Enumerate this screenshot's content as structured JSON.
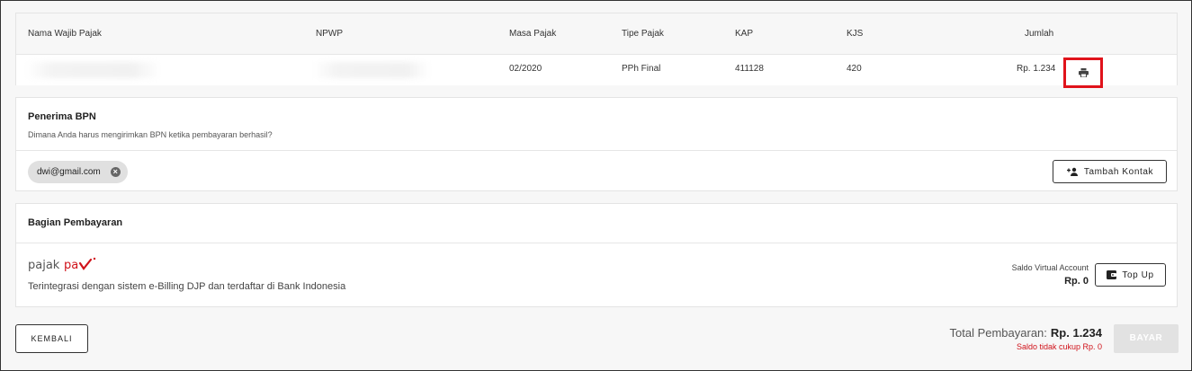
{
  "table": {
    "headers": {
      "nama": "Nama Wajib Pajak",
      "npwp": "NPWP",
      "masa": "Masa Pajak",
      "tipe": "Tipe Pajak",
      "kap": "KAP",
      "kjs": "KJS",
      "jumlah": "Jumlah"
    },
    "row": {
      "nama": "",
      "npwp": "",
      "masa": "02/2020",
      "tipe": "PPh Final",
      "kap": "411128",
      "kjs": "420",
      "jumlah": "Rp. 1.234"
    },
    "print_icon": "printer-icon",
    "highlight_color": "#e0131b"
  },
  "recipient": {
    "title": "Penerima BPN",
    "subtitle": "Dimana Anda harus mengirimkan BPN ketika pembayaran berhasil?",
    "chip": "dwi@gmail.com",
    "chip_remove_icon": "close-circle-icon",
    "add_contact_label": "Tambah Kontak",
    "add_contact_icon": "person-add-icon"
  },
  "payment": {
    "title": "Bagian Pembayaran",
    "logo_text": "pajakpay",
    "description": "Terintegrasi dengan sistem e-Billing DJP dan terdaftar di Bank Indonesia",
    "balance_label": "Saldo Virtual Account",
    "balance_value": "Rp. 0",
    "topup_label": "Top Up",
    "topup_icon": "wallet-icon"
  },
  "footer": {
    "back_label": "KEMBALI",
    "total_label": "Total Pembayaran:",
    "total_value": "Rp. 1.234",
    "warning": "Saldo tidak cukup Rp. 0",
    "pay_label": "BAYAR"
  },
  "colors": {
    "brand_red": "#d0131b",
    "disabled": "#e2e2e2"
  }
}
